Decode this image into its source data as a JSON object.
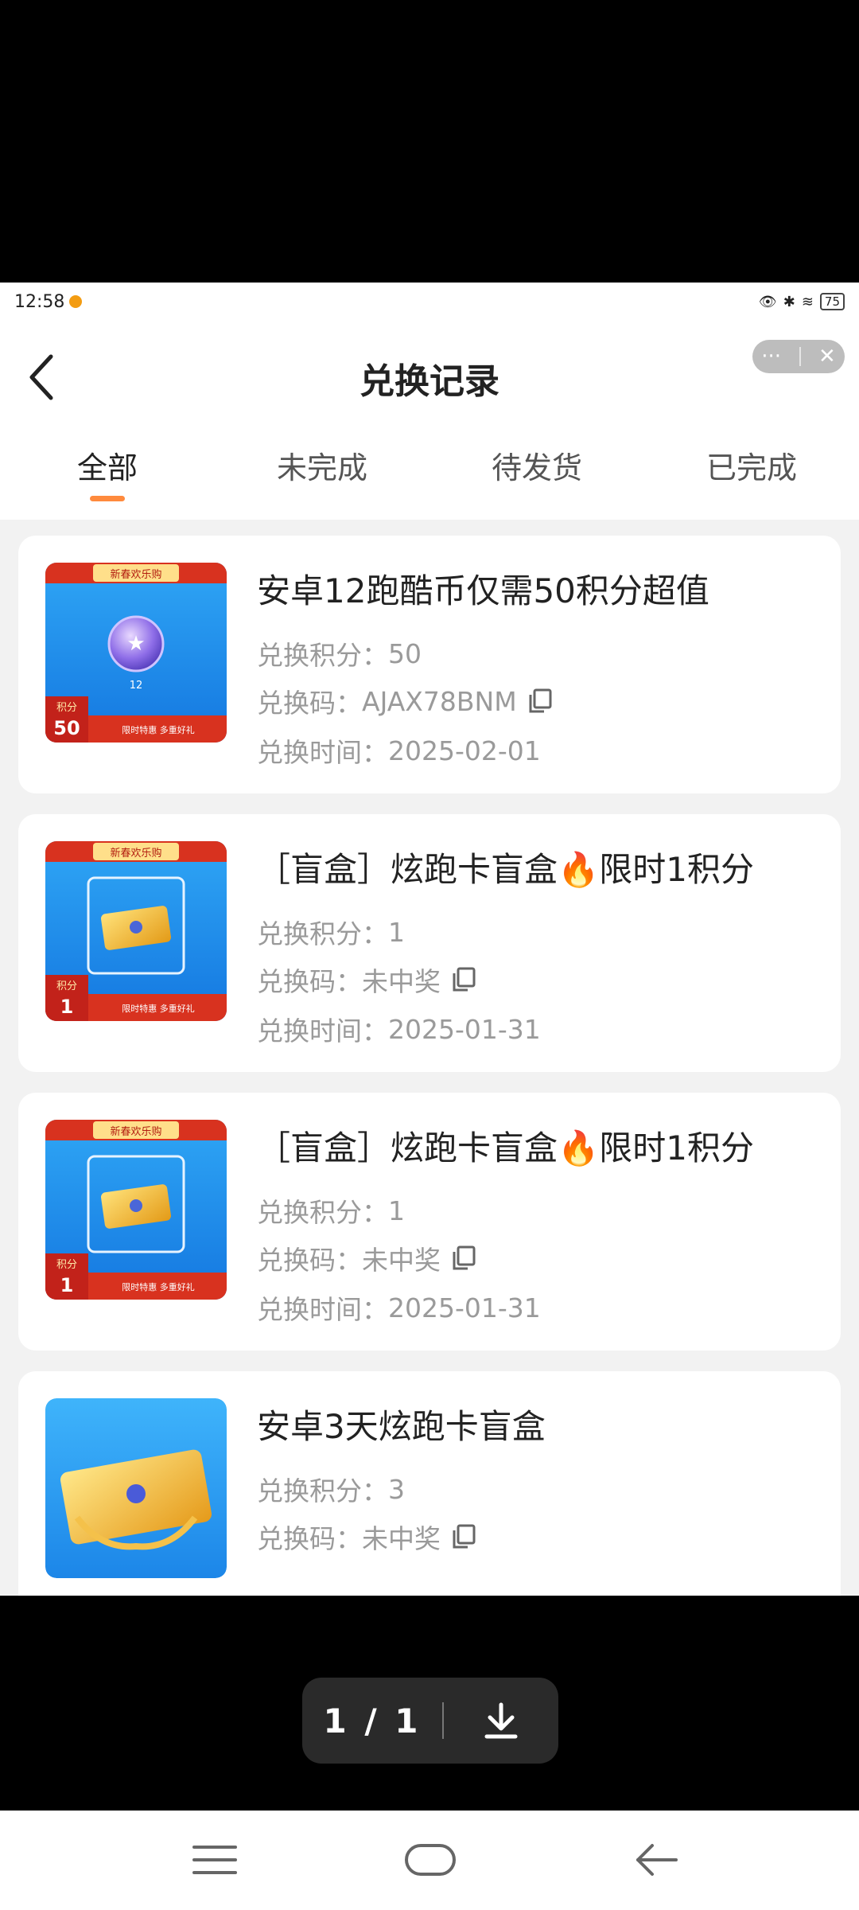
{
  "status": {
    "time": "12:58",
    "battery": "75"
  },
  "header": {
    "title": "兑换记录",
    "capsule_more": "···",
    "capsule_close": "✕"
  },
  "tabs": [
    {
      "label": "全部",
      "active": true
    },
    {
      "label": "未完成",
      "active": false
    },
    {
      "label": "待发货",
      "active": false
    },
    {
      "label": "已完成",
      "active": false
    }
  ],
  "records": [
    {
      "title": "安卓12跑酷币仅需50积分超值",
      "points_label": "兑换积分：",
      "points": "50",
      "code_label": "兑换码：",
      "code": "AJAX78BNM",
      "time_label": "兑换时间：",
      "time": "2025-02-01",
      "thumb": {
        "banner": "新春欢乐购",
        "points_tag": "积分",
        "points_value": "50",
        "slogan": "限时特惠 多重好礼",
        "coin_label": "12"
      }
    },
    {
      "title": "［盲盒］炫跑卡盲盒🔥限时1积分",
      "points_label": "兑换积分：",
      "points": "1",
      "code_label": "兑换码：",
      "code": "未中奖",
      "time_label": "兑换时间：",
      "time": "2025-01-31",
      "thumb": {
        "banner": "新春欢乐购",
        "points_tag": "积分",
        "points_value": "1",
        "slogan": "限时特惠 多重好礼"
      }
    },
    {
      "title": "［盲盒］炫跑卡盲盒🔥限时1积分",
      "points_label": "兑换积分：",
      "points": "1",
      "code_label": "兑换码：",
      "code": "未中奖",
      "time_label": "兑换时间：",
      "time": "2025-01-31",
      "thumb": {
        "banner": "新春欢乐购",
        "points_tag": "积分",
        "points_value": "1",
        "slogan": "限时特惠 多重好礼"
      }
    },
    {
      "title": "安卓3天炫跑卡盲盒",
      "points_label": "兑换积分：",
      "points": "3",
      "code_label": "兑换码：",
      "code": "未中奖"
    }
  ],
  "viewer": {
    "page_indicator": "1 / 1"
  }
}
